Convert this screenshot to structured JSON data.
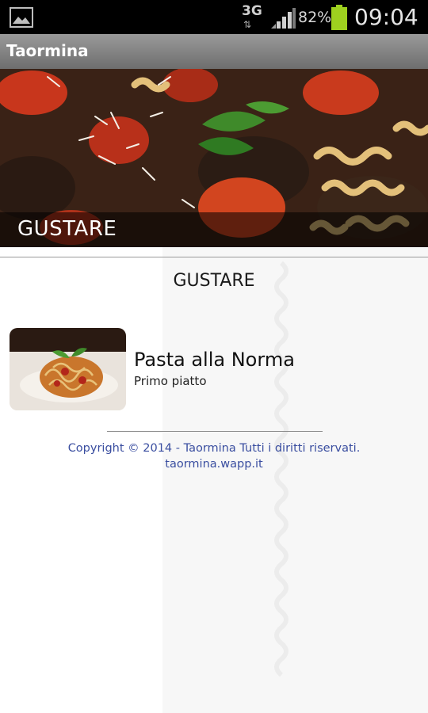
{
  "status_bar": {
    "network": "3G",
    "battery_percent": "82%",
    "time": "09:04",
    "battery_color": "#9ed11f",
    "icons": [
      "gallery-icon",
      "signal-icon",
      "battery-icon"
    ]
  },
  "app": {
    "title": "Taormina"
  },
  "header": {
    "caption": "GUSTARE"
  },
  "section": {
    "heading": "GUSTARE"
  },
  "items": [
    {
      "title": "Pasta alla Norma",
      "subtitle": "Primo piatto"
    }
  ],
  "footer": {
    "copyright": "Copyright © 2014 - Taormina Tutti i diritti riservati.",
    "link": "taormina.wapp.it",
    "link_color": "#3a4ea0"
  }
}
